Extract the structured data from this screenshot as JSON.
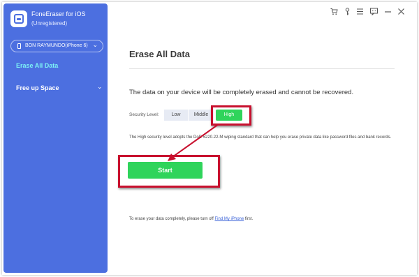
{
  "app": {
    "title": "FoneEraser for iOS",
    "subtitle": "(Unregistered)",
    "logo_icon": "app-logo-icon",
    "accent_color": "#4c6fe0"
  },
  "device": {
    "name": "BON RAYMUNDO(iPhone 6)",
    "icon": "phone-icon"
  },
  "sidebar": {
    "items": [
      {
        "label": "Erase All Data",
        "active": true,
        "color": "#7df3f5"
      },
      {
        "label": "Free up Space",
        "active": false,
        "has_submenu": true
      }
    ]
  },
  "toolbar": {
    "icons": [
      "cart-icon",
      "key-icon",
      "menu-icon",
      "chat-icon",
      "minimize-icon",
      "close-icon"
    ]
  },
  "main": {
    "title": "Erase All Data",
    "warning": "The data on your device will be completely erased and cannot be recovered.",
    "security_label": "Security Level:",
    "levels": [
      "Low",
      "Middle",
      "High"
    ],
    "selected_level": "High",
    "description": "The High security level adopts the DoD 5220.22-M wiping standard that can help you erase private data like password files and bank records.",
    "start_label": "Start",
    "footer_prefix": "To erase your data completely, please turn off ",
    "footer_link": "Find My iPhone",
    "footer_suffix": " first.",
    "success_color": "#2fd45b",
    "annotation_color": "#c8102e"
  }
}
